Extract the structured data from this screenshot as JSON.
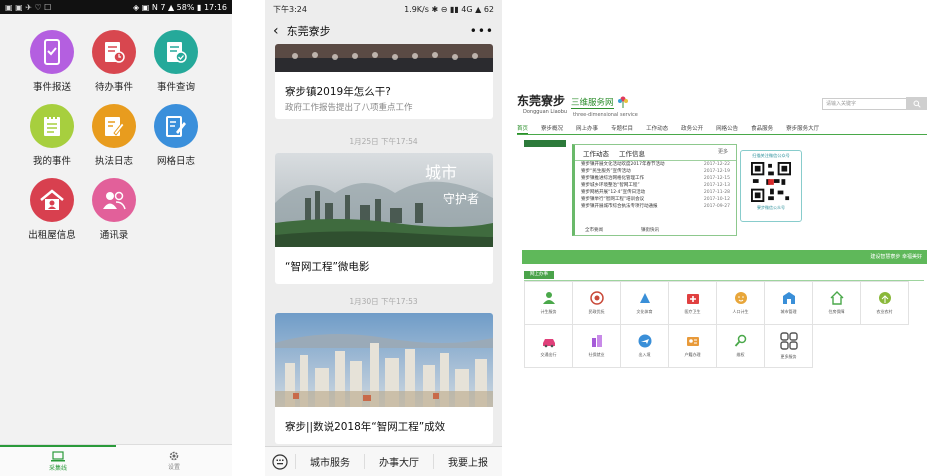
{
  "phone1": {
    "status_left": "▣ ▣ ✈ ♡ ☐",
    "status_right": "◈ ▣ N 7 ▲ 58% ▮ 17:16",
    "apps": [
      {
        "label": "事件报送",
        "color": "#b45fe0",
        "icon": "phone-icon"
      },
      {
        "label": "待办事件",
        "color": "#d8474f",
        "icon": "clipboard-clock-icon"
      },
      {
        "label": "事件查询",
        "color": "#25a99a",
        "icon": "clipboard-check-icon"
      },
      {
        "label": "我的事件",
        "color": "#a7cf3e",
        "icon": "notepad-icon"
      },
      {
        "label": "执法日志",
        "color": "#e89c1e",
        "icon": "pencil-note-icon"
      },
      {
        "label": "网格日志",
        "color": "#3a8fdb",
        "icon": "edit-list-icon"
      },
      {
        "label": "出租屋信息",
        "color": "#d8404f",
        "icon": "house-icon"
      },
      {
        "label": "通讯录",
        "color": "#e2609a",
        "icon": "contacts-icon"
      }
    ],
    "tabs": [
      {
        "label": "采集线",
        "active": true
      },
      {
        "label": "设置",
        "active": false
      }
    ]
  },
  "phone2": {
    "time": "下午3:24",
    "status_right": "1.9K/s ✱ ⊖ ▮▮ 4G ▲ 62",
    "title": "东莞寮步",
    "articles": [
      {
        "title": "寮步镇2019年怎么干?",
        "subtitle": "政府工作报告提出了八项重点工作"
      },
      {
        "timestamp": "1月25日 下午17:54",
        "title": "“智网工程”微电影",
        "overlay": "城市守护者"
      },
      {
        "timestamp": "1月30日 下午17:53",
        "title": "寮步||数说2018年“智网工程”成效"
      }
    ],
    "menu": [
      "城市服务",
      "办事大厅",
      "我要上报"
    ]
  },
  "site": {
    "logo_cn": "东莞寮步",
    "logo_py": "Dongguan Liaobu",
    "brand": "三维服务网",
    "brand_en": "three-dimensional service",
    "search_placeholder": "请输入关键字",
    "nav": [
      "首页",
      "寮步概况",
      "网上办事",
      "专题栏目",
      "工作动态",
      "政务公开",
      "网格公告",
      "食品服务",
      "寮步服务大厅"
    ],
    "news_tabs": [
      "工作动态",
      "工作信息"
    ],
    "news_more": "更多",
    "news": [
      {
        "t": "寮步镇开展文化活动欢度2017年春节活动",
        "d": "2017-12-22"
      },
      {
        "t": "寮步“民生服务”宣传活动",
        "d": "2017-12-19"
      },
      {
        "t": "寮步镇推进综治网格化管理工作",
        "d": "2017-12-15"
      },
      {
        "t": "寮步城乡环境整治“智网工程”",
        "d": "2017-12-13"
      },
      {
        "t": "寮步网格开展“12·4”宣传日活动",
        "d": "2017-11-28"
      },
      {
        "t": "寮步镇举行“智网工程”培训会议",
        "d": "2017-10-12"
      },
      {
        "t": "寮步镇开展城市综合执法专项行动通报",
        "d": "2017-09-27"
      }
    ],
    "news_foot": [
      "全市要闻",
      "镇街快讯"
    ],
    "qr_top": "扫描关注微信公众号",
    "qr_bottom": "寮步微信公众号",
    "green_bar": "建设智慧寮步 幸福美好",
    "services_title": "网上办事",
    "services": [
      {
        "label": "计生服务",
        "color": "#4aa84a"
      },
      {
        "label": "民政优抚",
        "color": "#c94a3a"
      },
      {
        "label": "文化体育",
        "color": "#3a8fd8"
      },
      {
        "label": "医疗卫生",
        "color": "#e04040"
      },
      {
        "label": "人口计生",
        "color": "#e8a63a"
      },
      {
        "label": "城市管理",
        "color": "#3a8fd8"
      },
      {
        "label": "住房保障",
        "color": "#4aa84a"
      },
      {
        "label": "农业农村",
        "color": "#8ab83a"
      },
      {
        "label": "交通出行",
        "color": "#e0407a"
      },
      {
        "label": "社保就业",
        "color": "#a55ad8"
      },
      {
        "label": "出入境",
        "color": "#3a8fd8"
      },
      {
        "label": "户籍办理",
        "color": "#e89a3a"
      },
      {
        "label": "维权",
        "color": "#4aa84a"
      },
      {
        "label": "更多服务",
        "color": "#555555"
      }
    ]
  }
}
